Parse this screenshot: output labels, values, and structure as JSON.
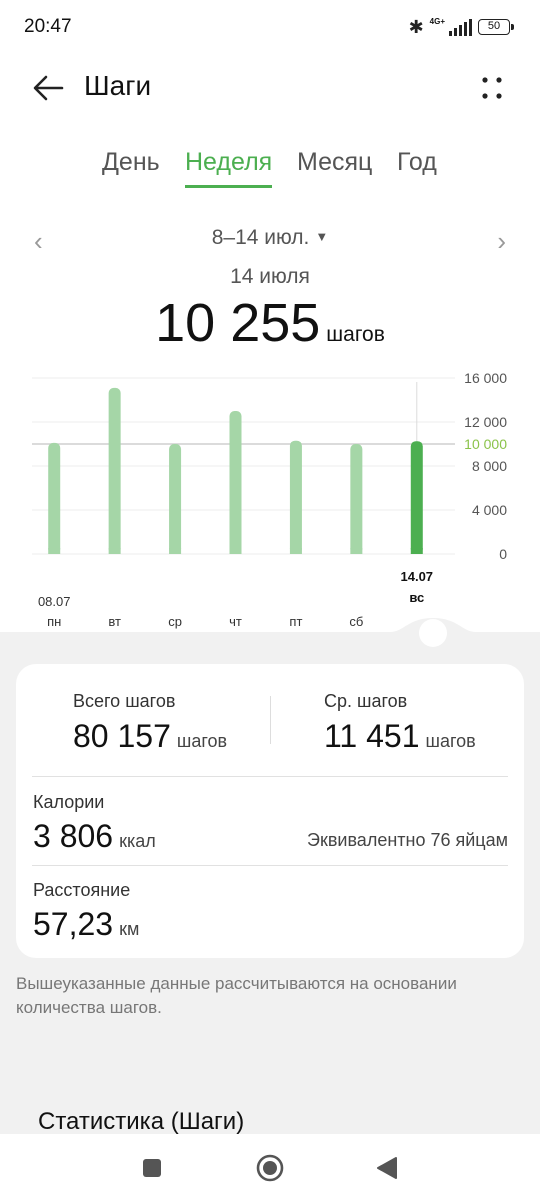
{
  "status": {
    "time": "20:47",
    "network": "4G+",
    "battery": "50"
  },
  "header": {
    "title": "Шаги"
  },
  "tabs": [
    {
      "label": "День",
      "active": false
    },
    {
      "label": "Неделя",
      "active": true
    },
    {
      "label": "Месяц",
      "active": false
    },
    {
      "label": "Год",
      "active": false
    }
  ],
  "range": {
    "label": "8–14 июл."
  },
  "selected": {
    "date": "14 июля",
    "value": "10 255",
    "unit": "шагов"
  },
  "chart_data": {
    "type": "bar",
    "categories": [
      "пн",
      "вт",
      "ср",
      "чт",
      "пт",
      "сб",
      "вс"
    ],
    "date_labels": {
      "пн": "08.07",
      "вс": "14.07"
    },
    "values": [
      10100,
      15100,
      10000,
      13000,
      10300,
      10000,
      10255
    ],
    "selected_index": 6,
    "goal": 10000,
    "goal_label": "10 000",
    "yticks": [
      "16 000",
      "12 000",
      "8 000",
      "4 000",
      "0"
    ],
    "ylim": [
      0,
      16000
    ],
    "colors": {
      "bar": "#a5d6a7",
      "selected": "#4caf50",
      "goal": "#8bc34a"
    }
  },
  "summary": {
    "total_label": "Всего шагов",
    "total_value": "80 157",
    "total_unit": "шагов",
    "avg_label": "Ср. шагов",
    "avg_value": "11 451",
    "avg_unit": "шагов",
    "cal_label": "Калории",
    "cal_value": "3 806",
    "cal_unit": "ккал",
    "equiv": "Эквивалентно 76 яйцам",
    "dist_label": "Расстояние",
    "dist_value": "57,23",
    "dist_unit": "км"
  },
  "note": "Вышеуказанные данные рассчитываются на основании количества шагов.",
  "stats_title": "Статистика (Шаги)"
}
